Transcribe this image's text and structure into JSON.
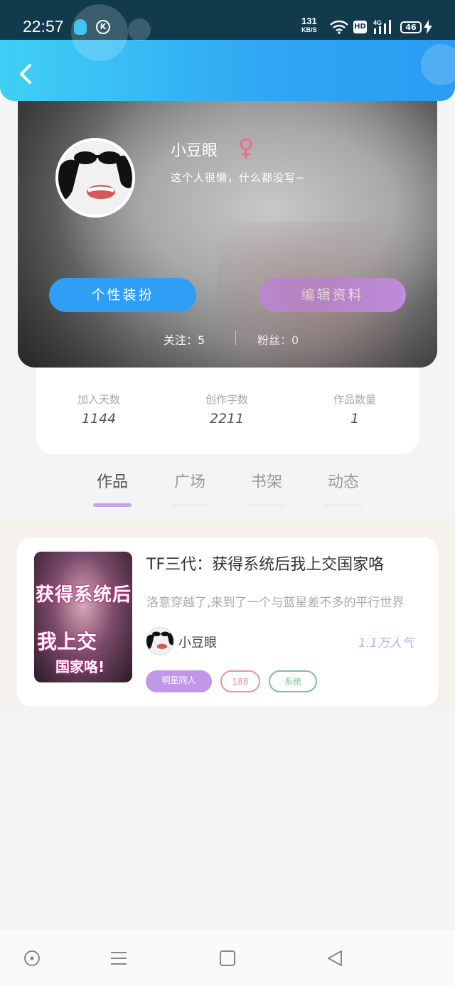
{
  "status_bar": {
    "time": "22:57",
    "net_speed": "131",
    "net_speed_unit": "KB/S",
    "hd": "HD",
    "network": "4G",
    "battery": "46"
  },
  "header": {
    "back_icon": "chevron-left-icon",
    "gradient_from": "#3fd0f5",
    "gradient_to": "#2a9cf3"
  },
  "profile": {
    "nickname": "小豆眼",
    "gender_symbol": "♀",
    "bio": "这个人很懒，什么都没写~",
    "decorate_button": "个性装扮",
    "edit_button": "编辑资料",
    "following": "关注：5",
    "followers": "粉丝：0"
  },
  "stats": [
    {
      "label": "加入天数",
      "value": "1144"
    },
    {
      "label": "创作字数",
      "value": "2211"
    },
    {
      "label": "作品数量",
      "value": "1"
    }
  ],
  "tabs": [
    {
      "label": "作品",
      "active": true
    },
    {
      "label": "广场",
      "active": false
    },
    {
      "label": "书架",
      "active": false
    },
    {
      "label": "动态",
      "active": false
    }
  ],
  "works": [
    {
      "title": "TF三代：获得系统后我上交国家咯",
      "description": "洛意穿越了,来到了一个与蓝星差不多的平行世界",
      "author": "小豆眼",
      "popularity": "1.1万人气",
      "cover_text": [
        "获得系统后",
        "我上交",
        "国家咯!"
      ],
      "tags": [
        "明星同人",
        "188",
        "系统"
      ]
    }
  ],
  "colors": {
    "accent_blue": "#2f9ff6",
    "accent_purple": "#c08ee6",
    "tab_active": "#c6a5ea"
  }
}
